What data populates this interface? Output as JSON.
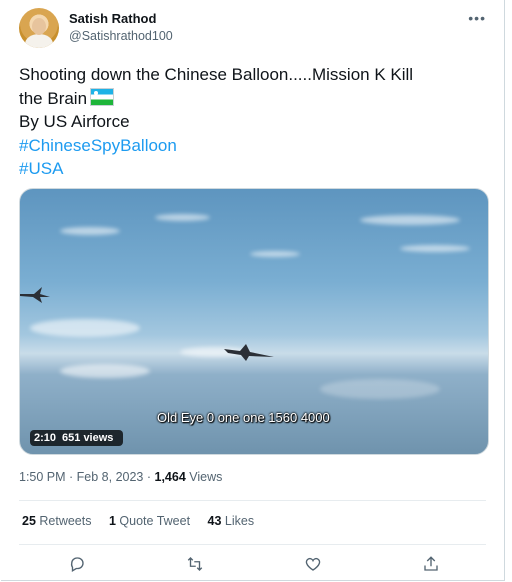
{
  "author": {
    "name": "Satish Rathod",
    "handle": "@Satishrathod100"
  },
  "more_icon": "more-icon",
  "tweet": {
    "lines": [
      "Shooting down the Chinese Balloon.....Mission K Kill",
      "the Brain",
      "By US Airforce"
    ],
    "hashtags": [
      "#ChineseSpyBalloon",
      "#USA"
    ]
  },
  "video": {
    "subtitle": "Old Eye 0 one one 1560 4000",
    "duration": "2:10",
    "views": "651 views"
  },
  "meta": {
    "time": "1:50 PM · Feb 8, 2023 · ",
    "views_count": "1,464",
    "views_label": " Views"
  },
  "stats": {
    "retweets_count": "25",
    "retweets_label": " Retweets",
    "quotes_count": "1",
    "quotes_label": " Quote Tweet",
    "likes_count": "43",
    "likes_label": " Likes"
  },
  "actions": [
    "reply-icon",
    "retweet-icon",
    "like-icon",
    "share-icon"
  ]
}
